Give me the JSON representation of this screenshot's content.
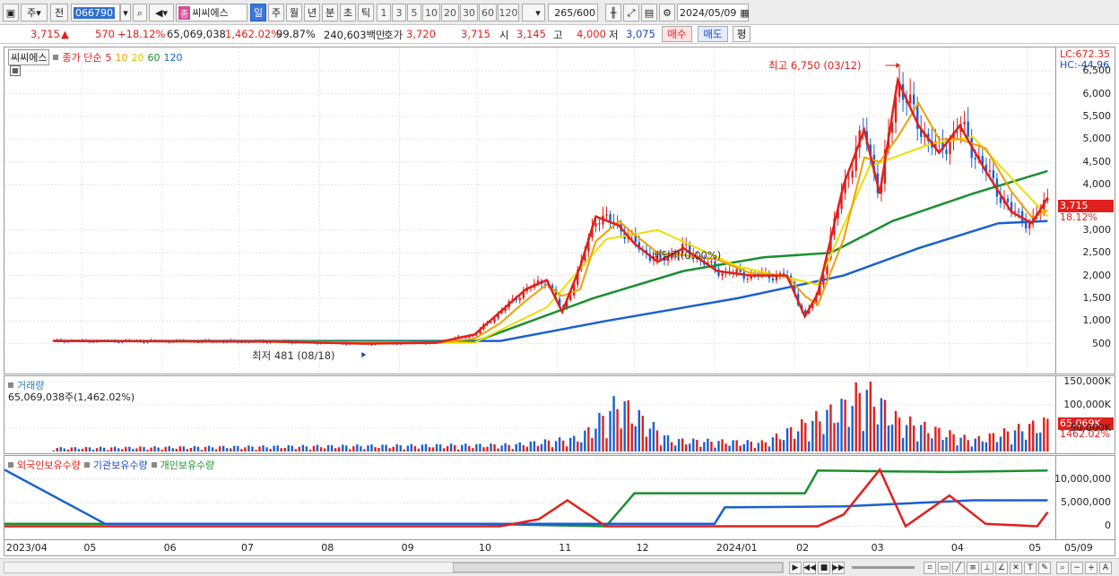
{
  "toolbar": {
    "main_toggle": "주",
    "prev_label": "전",
    "code": "066790",
    "name_badge": "종",
    "stock_name": "씨씨에스",
    "periods": [
      "일",
      "주",
      "월",
      "년",
      "분",
      "초",
      "틱"
    ],
    "active_period": "일",
    "intervals": [
      "1",
      "3",
      "5",
      "10",
      "20",
      "30",
      "60",
      "120"
    ],
    "count": "265",
    "count_total": "/600",
    "date": "2024/05/09"
  },
  "quote": {
    "price": "3,715",
    "change": "570",
    "change_pct": "+18.12%",
    "volume": "65,069,038",
    "volume_pct": "1,462.02%",
    "ratio": "99.87%",
    "amount": "240,603백만",
    "bid_label": "호가",
    "bid": "3,720",
    "ask": "3,715",
    "open_label": "시",
    "open": "3,145",
    "high_label": "고",
    "high": "4,000",
    "low_label": "저",
    "low": "3,075",
    "buy_label": "매수",
    "sell_label": "매도",
    "avg_label": "평"
  },
  "price_pane": {
    "legend_name": "씨씨에스",
    "legend_ma": "종가 단순",
    "ma_periods": [
      "5",
      "10",
      "20",
      "60",
      "120"
    ],
    "ma_colors": [
      "#e0201c",
      "#f0a000",
      "#e8e000",
      "#1a8f2e",
      "#1a60d0"
    ],
    "lc": "LC:672.35",
    "hc": "HC:-44.96",
    "current_price": "3,715",
    "current_pct": "18.12%",
    "high_annotation": "최고 6,750 (03/12)",
    "low_annotation": "최저 481 (08/18)",
    "div_annotation": "배당락(0.00%)",
    "ticks": [
      "6,500",
      "6,000",
      "5,500",
      "5,000",
      "4,500",
      "4,000",
      "3,000",
      "2,500",
      "2,000",
      "1,500",
      "1,000",
      "500"
    ]
  },
  "volume_pane": {
    "legend": "거래량",
    "subtitle": "65,069,038주(1,462.02%)",
    "ticks": [
      "150,000K",
      "100,000K",
      "50,000K"
    ],
    "current": "65,069K",
    "current_pct": "1462.02%"
  },
  "holdings_pane": {
    "legend": [
      "외국인보유수량",
      "기관보유수량",
      "개인보유수량"
    ],
    "colors": [
      "#e0201c",
      "#1a60d0",
      "#1a8f2e"
    ],
    "ticks": [
      "10,000,000",
      "5,000,000",
      "0"
    ]
  },
  "date_axis": [
    "2023/04",
    "05",
    "06",
    "07",
    "08",
    "09",
    "10",
    "11",
    "12",
    "2024/01",
    "02",
    "03",
    "04",
    "05",
    "05/09"
  ],
  "chart_data": {
    "type": "candlestick",
    "price_range": [
      0,
      6900
    ],
    "volume_range": [
      0,
      150000
    ],
    "holdings_range": [
      -2000000,
      13000000
    ],
    "months": [
      "2023/04",
      "05",
      "06",
      "07",
      "08",
      "09",
      "10",
      "11",
      "12",
      "2024/01",
      "02",
      "03",
      "04",
      "05"
    ],
    "close_series": [
      [
        "2023-04-20",
        560
      ],
      [
        "2023-05-15",
        555
      ],
      [
        "2023-06-15",
        550
      ],
      [
        "2023-07-15",
        545
      ],
      [
        "2023-08-18",
        500
      ],
      [
        "2023-09-15",
        520
      ],
      [
        "2023-09-30",
        700
      ],
      [
        "2023-10-10",
        1200
      ],
      [
        "2023-10-20",
        1700
      ],
      [
        "2023-10-28",
        1900
      ],
      [
        "2023-11-03",
        1200
      ],
      [
        "2023-11-10",
        2200
      ],
      [
        "2023-11-16",
        3300
      ],
      [
        "2023-11-25",
        3100
      ],
      [
        "2023-12-01",
        2700
      ],
      [
        "2023-12-10",
        2300
      ],
      [
        "2023-12-20",
        2600
      ],
      [
        "2024-01-02",
        2100
      ],
      [
        "2024-01-15",
        2000
      ],
      [
        "2024-01-29",
        2000
      ],
      [
        "2024-02-05",
        1100
      ],
      [
        "2024-02-10",
        1600
      ],
      [
        "2024-02-20",
        4000
      ],
      [
        "2024-02-28",
        5200
      ],
      [
        "2024-03-05",
        3800
      ],
      [
        "2024-03-12",
        6300
      ],
      [
        "2024-03-20",
        5300
      ],
      [
        "2024-03-28",
        4700
      ],
      [
        "2024-04-05",
        5300
      ],
      [
        "2024-04-15",
        4300
      ],
      [
        "2024-04-25",
        3400
      ],
      [
        "2024-05-03",
        3150
      ],
      [
        "2024-05-09",
        3715
      ]
    ],
    "ma60": [
      [
        "2023-04-20",
        560
      ],
      [
        "2023-09-30",
        540
      ],
      [
        "2023-11-15",
        1500
      ],
      [
        "2023-12-20",
        2100
      ],
      [
        "2024-01-20",
        2400
      ],
      [
        "2024-02-15",
        2500
      ],
      [
        "2024-03-10",
        3200
      ],
      [
        "2024-04-10",
        3800
      ],
      [
        "2024-05-09",
        4300
      ]
    ],
    "ma120": [
      [
        "2023-04-20",
        560
      ],
      [
        "2023-10-10",
        560
      ],
      [
        "2023-11-20",
        1000
      ],
      [
        "2024-01-10",
        1500
      ],
      [
        "2024-02-20",
        2000
      ],
      [
        "2024-03-20",
        2600
      ],
      [
        "2024-04-20",
        3150
      ],
      [
        "2024-05-09",
        3200
      ]
    ],
    "ma20": [
      [
        "2023-04-20",
        560
      ],
      [
        "2023-09-30",
        520
      ],
      [
        "2023-10-28",
        1300
      ],
      [
        "2023-11-20",
        2800
      ],
      [
        "2023-12-10",
        3000
      ],
      [
        "2024-01-10",
        2200
      ],
      [
        "2024-02-10",
        1800
      ],
      [
        "2024-03-01",
        4400
      ],
      [
        "2024-03-25",
        4900
      ],
      [
        "2024-04-10",
        5050
      ],
      [
        "2024-05-09",
        3300
      ]
    ],
    "volume": [
      [
        "2023-04-25",
        8000
      ],
      [
        "2023-10-15",
        15000
      ],
      [
        "2023-11-10",
        30000
      ],
      [
        "2023-11-25",
        110000
      ],
      [
        "2023-12-15",
        25000
      ],
      [
        "2024-01-20",
        20000
      ],
      [
        "2024-02-20",
        100000
      ],
      [
        "2024-02-28",
        140000
      ],
      [
        "2024-03-12",
        70000
      ],
      [
        "2024-04-10",
        25000
      ],
      [
        "2024-05-09",
        65069
      ]
    ],
    "foreign_holdings": [
      [
        "2023-04-01",
        0
      ],
      [
        "2023-05-15",
        0
      ],
      [
        "2023-10-10",
        0
      ],
      [
        "2023-10-25",
        1500000
      ],
      [
        "2023-11-05",
        5500000
      ],
      [
        "2023-11-20",
        0
      ],
      [
        "2024-02-10",
        0
      ],
      [
        "2024-02-20",
        2500000
      ],
      [
        "2024-03-05",
        12000000
      ],
      [
        "2024-03-15",
        0
      ],
      [
        "2024-04-01",
        6500000
      ],
      [
        "2024-04-15",
        500000
      ],
      [
        "2024-05-05",
        0
      ],
      [
        "2024-05-09",
        3000000
      ]
    ],
    "institution_holdings": [
      [
        "2023-04-01",
        12000000
      ],
      [
        "2023-05-10",
        500000
      ],
      [
        "2024-01-01",
        500000
      ],
      [
        "2024-01-05",
        4000000
      ],
      [
        "2024-02-20",
        4200000
      ],
      [
        "2024-04-10",
        5500000
      ],
      [
        "2024-05-09",
        5500000
      ]
    ],
    "individual_holdings": [
      [
        "2023-04-01",
        500000
      ],
      [
        "2023-10-01",
        500000
      ],
      [
        "2023-11-20",
        0
      ],
      [
        "2023-12-01",
        7000000
      ],
      [
        "2024-02-05",
        7000000
      ],
      [
        "2024-02-10",
        11800000
      ],
      [
        "2024-04-01",
        11500000
      ],
      [
        "2024-05-09",
        11800000
      ]
    ]
  }
}
